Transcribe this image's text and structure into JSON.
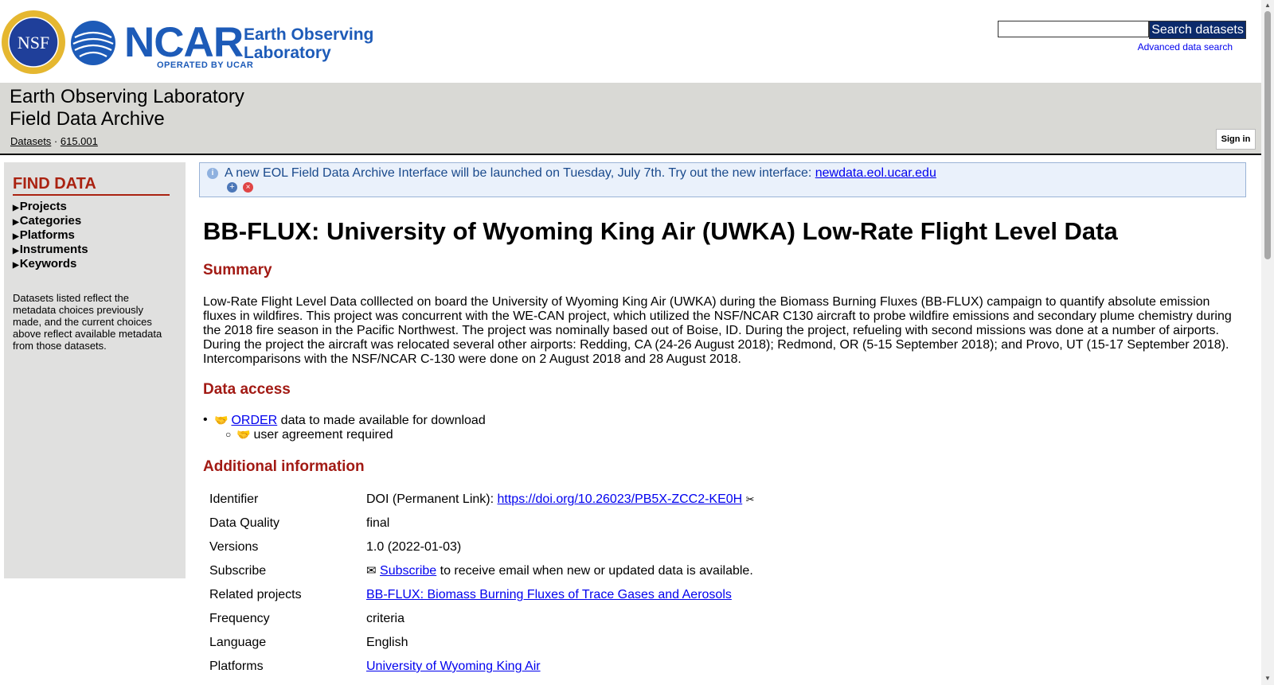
{
  "header": {
    "nsf_logo_text": "NSF",
    "ncar_wordmark": "NCAR",
    "ncar_operated": "OPERATED BY UCAR",
    "eol_line1": "Earth Observing",
    "eol_line2": "Laboratory",
    "search_button": "Search datasets",
    "advanced_search": "Advanced data search"
  },
  "banner": {
    "title_line1": "Earth Observing Laboratory",
    "title_line2": "Field Data Archive",
    "crumb_datasets": "Datasets",
    "crumb_sep": " · ",
    "crumb_id": "615.001",
    "sign_in": "Sign in"
  },
  "sidebar": {
    "heading": "FIND DATA",
    "items": [
      "Projects",
      "Categories",
      "Platforms",
      "Instruments",
      "Keywords"
    ],
    "note": "Datasets listed reflect the metadata choices previously made, and the current choices above reflect available metadata from those datasets."
  },
  "notice": {
    "text": "A new EOL Field Data Archive Interface will be launched on Tuesday, July 7th. Try out the new interface: ",
    "link": "newdata.eol.ucar.edu"
  },
  "main": {
    "title": "BB-FLUX: University of Wyoming King Air (UWKA) Low-Rate Flight Level Data",
    "summary_heading": "Summary",
    "summary": "Low-Rate Flight Level Data colllected on board the University of Wyoming King Air (UWKA) during the Biomass Burning Fluxes (BB-FLUX) campaign to quantify absolute emission fluxes in wildfires. This project was concurrent with the WE-CAN project, which utilized the NSF/NCAR C130 aircraft to probe wildfire emissions and secondary plume chemistry during the 2018 fire season in the Pacific Northwest. The project was nominally based out of Boise, ID.  During the project, refueling with second missions was done at a number of airports. During the project the aircraft was relocated several other airports: Redding, CA (24-26 August 2018); Redmond, OR (5-15 September 2018); and Provo, UT (15-17 September 2018). Intercomparisons with the NSF/NCAR C-130 were done on 2 August 2018 and 28 August 2018.",
    "access_heading": "Data access",
    "order_link": "ORDER",
    "order_rest": " data to made available for download",
    "agreement": "user agreement required",
    "additional_heading": "Additional information",
    "info": {
      "identifier_key": "Identifier",
      "identifier_prefix": "DOI (Permanent Link): ",
      "identifier_link": "https://doi.org/10.26023/PB5X-ZCC2-KE0H",
      "quality_key": "Data Quality",
      "quality_val": "final",
      "versions_key": "Versions",
      "versions_val": "1.0 (2022-01-03)",
      "subscribe_key": "Subscribe",
      "subscribe_link": "Subscribe",
      "subscribe_rest": " to receive email when new or updated data is available.",
      "related_key": "Related projects",
      "related_link": "BB-FLUX: Biomass Burning Fluxes of Trace Gases and Aerosols",
      "frequency_key": "Frequency",
      "frequency_val": "criteria",
      "language_key": "Language",
      "language_val": "English",
      "platforms_key": "Platforms",
      "platforms_link": "University of Wyoming King Air"
    }
  },
  "icons": {
    "info": "info-icon",
    "expand": "expand-icon",
    "close": "close-icon",
    "handshake": "handshake-icon",
    "envelope": "envelope-icon",
    "clipboard": "clipboard-icon"
  }
}
